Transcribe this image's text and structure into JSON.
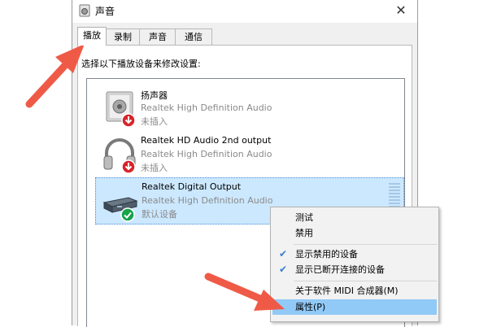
{
  "window": {
    "title": "声音"
  },
  "tabs": [
    {
      "label": "播放"
    },
    {
      "label": "录制"
    },
    {
      "label": "声音"
    },
    {
      "label": "通信"
    }
  ],
  "panel": {
    "instruction": "选择以下播放设备来修改设置:"
  },
  "devices": [
    {
      "name": "扬声器",
      "subtitle": "Realtek High Definition Audio",
      "status": "未插入"
    },
    {
      "name": "Realtek HD Audio 2nd output",
      "subtitle": "Realtek High Definition Audio",
      "status": "未插入"
    },
    {
      "name": "Realtek Digital Output",
      "subtitle": "Realtek High Definition Audio",
      "status": "默认设备"
    }
  ],
  "context_menu": {
    "test": "测试",
    "disable": "禁用",
    "show_disabled": "显示禁用的设备",
    "show_disconnected": "显示已断开连接的设备",
    "about_midi": "关于软件 MIDI 合成器(M)",
    "properties": "属性(P)"
  },
  "colors": {
    "selection": "#cce8ff",
    "menu_highlight": "#91c9f7",
    "arrow": "#ef5a47",
    "status_red": "#d8232a",
    "status_green": "#16a34a"
  }
}
